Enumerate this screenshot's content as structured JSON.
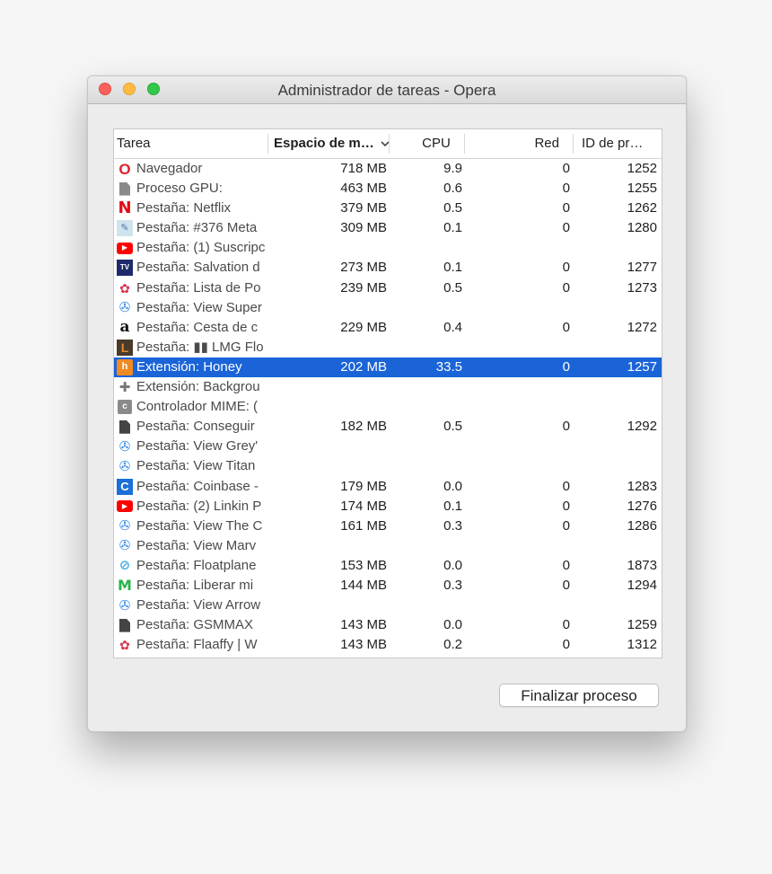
{
  "window": {
    "title": "Administrador de tareas - Opera"
  },
  "table": {
    "columns": {
      "name": "Tarea",
      "memory": "Espacio de m…",
      "memory_sort_icon": "chevron-down-icon",
      "cpu": "CPU",
      "network": "Red",
      "pid": "ID de pr…"
    },
    "rows": [
      {
        "icon": "opera-icon",
        "name": "Navegador",
        "memory": "718 MB",
        "cpu": "9.9",
        "network": "0",
        "pid": "1252"
      },
      {
        "icon": "document-gray-icon",
        "name": "Proceso GPU:",
        "memory": "463 MB",
        "cpu": "0.6",
        "network": "0",
        "pid": "1255"
      },
      {
        "icon": "netflix-icon",
        "name": "Pestaña: Netflix",
        "memory": "379 MB",
        "cpu": "0.5",
        "network": "0",
        "pid": "1262"
      },
      {
        "icon": "meta-icon",
        "name": "Pestaña: #376 Meta",
        "memory": "309 MB",
        "cpu": "0.1",
        "network": "0",
        "pid": "1280"
      },
      {
        "icon": "youtube-icon",
        "name": "Pestaña: (1) Suscripc",
        "memory": "",
        "cpu": "",
        "network": "",
        "pid": ""
      },
      {
        "icon": "tv-icon",
        "name": "Pestaña: Salvation d",
        "memory": "273 MB",
        "cpu": "0.1",
        "network": "0",
        "pid": "1277"
      },
      {
        "icon": "lips-icon",
        "name": "Pestaña: Lista de Po",
        "memory": "239 MB",
        "cpu": "0.5",
        "network": "0",
        "pid": "1273"
      },
      {
        "icon": "film-icon",
        "name": "Pestaña: View Super",
        "memory": "",
        "cpu": "",
        "network": "",
        "pid": ""
      },
      {
        "icon": "amazon-icon",
        "name": "Pestaña: Cesta de c",
        "memory": "229 MB",
        "cpu": "0.4",
        "network": "0",
        "pid": "1272"
      },
      {
        "icon": "lmg-icon",
        "name": "Pestaña: ▮▮ LMG Flo",
        "memory": "",
        "cpu": "",
        "network": "",
        "pid": ""
      },
      {
        "icon": "honey-icon",
        "name": "Extensión: Honey",
        "memory": "202 MB",
        "cpu": "33.5",
        "network": "0",
        "pid": "1257",
        "selected": true
      },
      {
        "icon": "puzzle-icon",
        "name": "Extensión: Backgrou",
        "memory": "",
        "cpu": "",
        "network": "",
        "pid": ""
      },
      {
        "icon": "c-gray-icon",
        "name": "Controlador MIME: (",
        "memory": "",
        "cpu": "",
        "network": "",
        "pid": ""
      },
      {
        "icon": "document-icon",
        "name": "Pestaña: Conseguir",
        "memory": "182 MB",
        "cpu": "0.5",
        "network": "0",
        "pid": "1292"
      },
      {
        "icon": "film-icon",
        "name": "Pestaña: View Grey'",
        "memory": "",
        "cpu": "",
        "network": "",
        "pid": ""
      },
      {
        "icon": "film-icon",
        "name": "Pestaña: View Titan",
        "memory": "",
        "cpu": "",
        "network": "",
        "pid": ""
      },
      {
        "icon": "coinbase-icon",
        "name": "Pestaña: Coinbase -",
        "memory": "179 MB",
        "cpu": "0.0",
        "network": "0",
        "pid": "1283"
      },
      {
        "icon": "youtube-icon",
        "name": "Pestaña: (2) Linkin P",
        "memory": "174 MB",
        "cpu": "0.1",
        "network": "0",
        "pid": "1276"
      },
      {
        "icon": "film-icon",
        "name": "Pestaña: View The C",
        "memory": "161 MB",
        "cpu": "0.3",
        "network": "0",
        "pid": "1286"
      },
      {
        "icon": "film-icon",
        "name": "Pestaña: View Marv",
        "memory": "",
        "cpu": "",
        "network": "",
        "pid": ""
      },
      {
        "icon": "floatplane-icon",
        "name": "Pestaña: Floatplane",
        "memory": "153 MB",
        "cpu": "0.0",
        "network": "0",
        "pid": "1873"
      },
      {
        "icon": "movistar-icon",
        "name": "Pestaña: Liberar mi",
        "memory": "144 MB",
        "cpu": "0.3",
        "network": "0",
        "pid": "1294"
      },
      {
        "icon": "film-icon",
        "name": "Pestaña: View Arrow",
        "memory": "",
        "cpu": "",
        "network": "",
        "pid": ""
      },
      {
        "icon": "document-icon",
        "name": "Pestaña: GSMMAX",
        "memory": "143 MB",
        "cpu": "0.0",
        "network": "0",
        "pid": "1259"
      },
      {
        "icon": "lips-icon",
        "name": "Pestaña: Flaaffy | W",
        "memory": "143 MB",
        "cpu": "0.2",
        "network": "0",
        "pid": "1312"
      }
    ]
  },
  "actions": {
    "end_process_label": "Finalizar proceso"
  },
  "colors": {
    "selection": "#1a64d8",
    "close": "#fc605c",
    "minimize": "#fdbc40",
    "maximize": "#34c84a"
  }
}
